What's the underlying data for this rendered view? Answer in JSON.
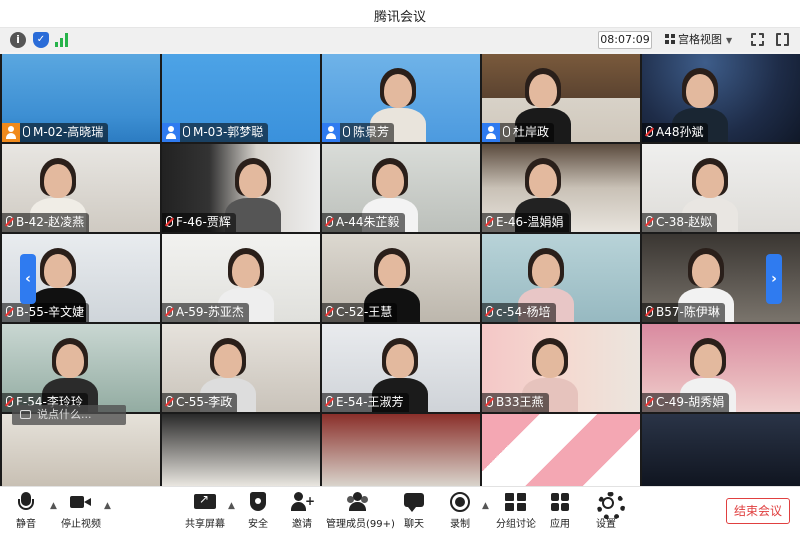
{
  "window": {
    "title": "腾讯会议"
  },
  "toolbar": {
    "info_icon": "info-icon",
    "security_icon": "shield-icon",
    "signal_icon": "signal-icon",
    "clock": "08:07:09",
    "view_mode": "宫格视图"
  },
  "chat_hint": "说点什么...",
  "tiles": [
    {
      "name": "M-02-高晓瑞",
      "host": "orange",
      "mic": "on"
    },
    {
      "name": "M-03-郭梦聪",
      "host": "blue",
      "mic": "on"
    },
    {
      "name": "陈景芳",
      "host": "blue",
      "mic": "on"
    },
    {
      "name": "杜岸政",
      "host": "blue",
      "mic": "on"
    },
    {
      "name": "A48孙斌",
      "host": "",
      "mic": "muted"
    },
    {
      "name": "B-42-赵凌燕",
      "host": "",
      "mic": "muted"
    },
    {
      "name": "F-46-贾辉",
      "host": "",
      "mic": "muted"
    },
    {
      "name": "A-44朱芷毅",
      "host": "",
      "mic": "muted"
    },
    {
      "name": "E-46-温娟娟",
      "host": "",
      "mic": "muted"
    },
    {
      "name": "C-38-赵姒",
      "host": "",
      "mic": "muted"
    },
    {
      "name": "B-55-辛文婕",
      "host": "",
      "mic": "muted"
    },
    {
      "name": "A-59-苏亚杰",
      "host": "",
      "mic": "muted"
    },
    {
      "name": "C-52-王慧",
      "host": "",
      "mic": "muted"
    },
    {
      "name": "c-54-杨培",
      "host": "",
      "mic": "muted"
    },
    {
      "name": "B57-陈伊琳",
      "host": "",
      "mic": "muted"
    },
    {
      "name": "F-54-李玲玲",
      "host": "",
      "mic": "muted"
    },
    {
      "name": "C-55-李政",
      "host": "",
      "mic": "muted"
    },
    {
      "name": "E-54-王淑芳",
      "host": "",
      "mic": "muted"
    },
    {
      "name": "B33王燕",
      "host": "",
      "mic": "muted"
    },
    {
      "name": "C-49-胡秀娟",
      "host": "",
      "mic": "muted"
    }
  ],
  "bottombar": {
    "mute": "静音",
    "stop_video": "停止视频",
    "share_screen": "共享屏幕",
    "security": "安全",
    "invite": "邀请",
    "members": "管理成员(99+)",
    "chat": "聊天",
    "record": "录制",
    "breakout": "分组讨论",
    "apps": "应用",
    "settings": "设置",
    "end_meeting": "结束会议"
  },
  "colors": {
    "accent": "#2f7bf0",
    "host_orange": "#f08a1c",
    "end_red": "#e04040"
  }
}
